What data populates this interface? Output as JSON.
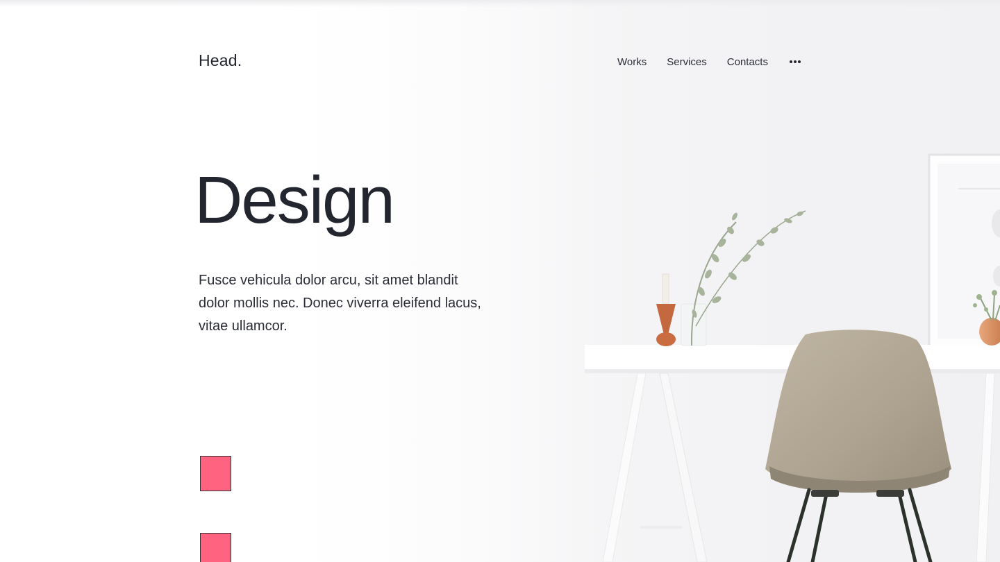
{
  "header": {
    "logo": "Head."
  },
  "nav": {
    "items": [
      {
        "label": "Works"
      },
      {
        "label": "Services"
      },
      {
        "label": "Contacts"
      }
    ],
    "more_icon": "more-horizontal-icon"
  },
  "hero": {
    "title": "Design",
    "description": "Fusce vehicula dolor arcu, sit amet blandit dolor mollis nec. Donec viverra eleifend lacus, vitae ullamcor."
  },
  "colors": {
    "accent": "#ff637f",
    "text": "#23252f",
    "chair": "#b5aa97",
    "wall": "#f4f4f6"
  }
}
